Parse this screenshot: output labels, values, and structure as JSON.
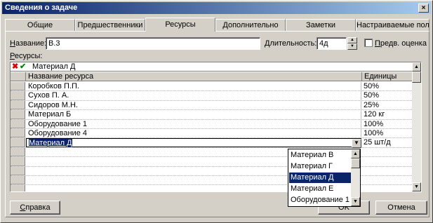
{
  "window": {
    "title": "Сведения о задаче",
    "close_glyph": "×"
  },
  "tabs": [
    {
      "label": "Общие"
    },
    {
      "label": "Предшественники"
    },
    {
      "label": "Ресурсы"
    },
    {
      "label": "Дополнительно"
    },
    {
      "label": "Заметки"
    },
    {
      "label": "Настраиваемые поля"
    }
  ],
  "active_tab": "Ресурсы",
  "fields": {
    "name_label": "Название:",
    "name_label_key": "Н",
    "name_label_rest": "азвание:",
    "name_value": "В.3",
    "duration_label": "Длительность:",
    "duration_label_key": "Д",
    "duration_label_rest": "лительность:",
    "duration_value": "4д",
    "estimate_label": "Предв. оценка",
    "estimate_label_key": "П",
    "estimate_label_rest": "редв. оценка",
    "estimate_checked": false
  },
  "resources_label": "Ресурсы:",
  "resources_label_key": "Р",
  "resources_label_rest": "есурсы:",
  "editbar": {
    "cancel_glyph": "✖",
    "confirm_glyph": "✔",
    "value": "Материал Д"
  },
  "table": {
    "columns": [
      "Название ресурса",
      "Единицы"
    ],
    "rows": [
      {
        "name": "Коробков П.П.",
        "units": "50%"
      },
      {
        "name": "Сухов П. А.",
        "units": "50%"
      },
      {
        "name": "Сидоров М.Н.",
        "units": "25%"
      },
      {
        "name": "Материал Б",
        "units": "120 кг"
      },
      {
        "name": "Оборудование 1",
        "units": "100%"
      },
      {
        "name": "Оборудование 4",
        "units": "100%"
      },
      {
        "name": "Материал Д",
        "units": "25 шт/д"
      }
    ]
  },
  "dropdown": {
    "options": [
      "Материал В",
      "Материал Г",
      "Материал Д",
      "Материал Е",
      "Оборудование 1"
    ],
    "selected": "Материал Д"
  },
  "buttons": {
    "help": "Справка",
    "help_key": "С",
    "help_rest": "правка",
    "ok": "OK",
    "cancel": "Отмена"
  },
  "colors": {
    "selection": "#0a246a",
    "titlebar_start": "#0a246a",
    "titlebar_end": "#a6caf0",
    "face": "#d4d0c8"
  }
}
